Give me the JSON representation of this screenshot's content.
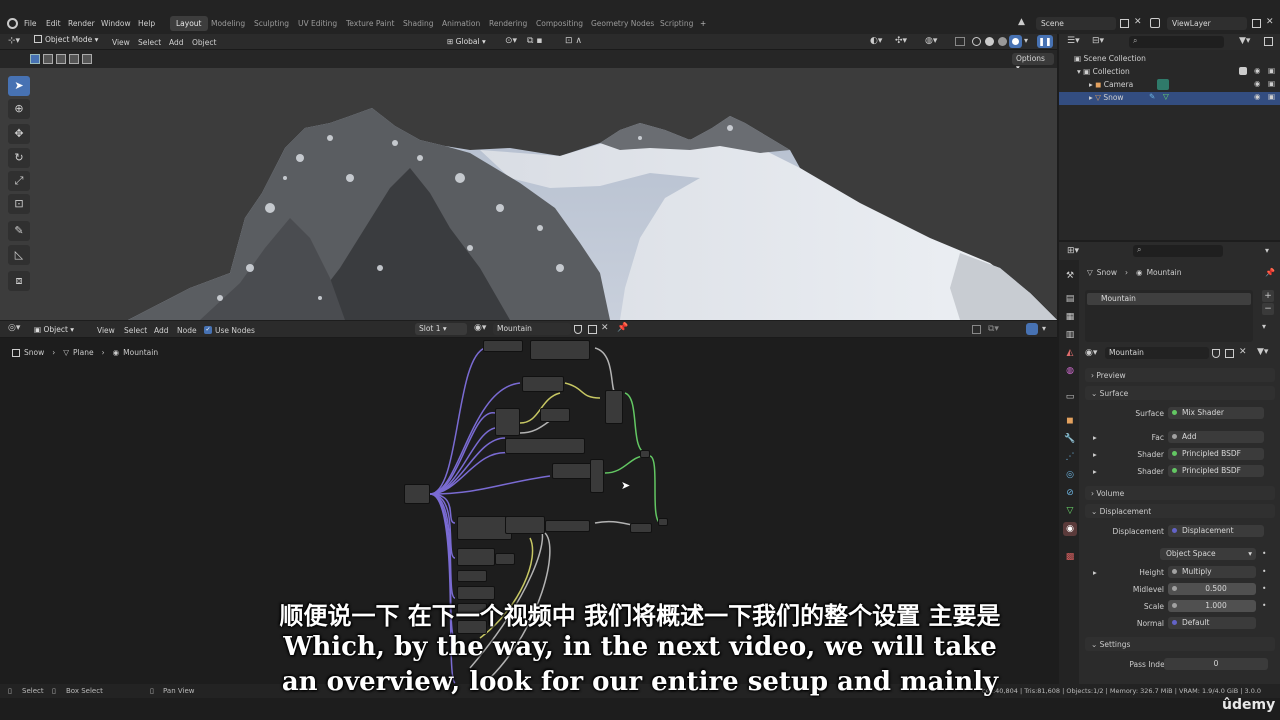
{
  "topbar": {
    "menus": [
      "File",
      "Edit",
      "Render",
      "Window",
      "Help"
    ],
    "workspaces": [
      "Layout",
      "Modeling",
      "Sculpting",
      "UV Editing",
      "Texture Paint",
      "Shading",
      "Animation",
      "Rendering",
      "Compositing",
      "Geometry Nodes",
      "Scripting"
    ],
    "add_tab": "+",
    "scene": "Scene",
    "view_layer": "ViewLayer"
  },
  "viewport": {
    "mode": "Object Mode",
    "menus": [
      "View",
      "Select",
      "Add",
      "Object"
    ],
    "orientation": "Global",
    "options_label": "Options"
  },
  "outliner": {
    "root": "Scene Collection",
    "items": [
      {
        "label": "Collection"
      },
      {
        "label": "Camera"
      },
      {
        "label": "Snow"
      }
    ]
  },
  "node_editor": {
    "type": "Object",
    "menus": [
      "View",
      "Select",
      "Add",
      "Node"
    ],
    "use_nodes_label": "Use Nodes",
    "slot": "Slot 1",
    "material": "Mountain",
    "breadcrumb": [
      "Snow",
      "Plane",
      "Mountain"
    ]
  },
  "properties": {
    "breadcrumb": [
      "Snow",
      "Mountain"
    ],
    "material_slot": "Mountain",
    "material_name": "Mountain",
    "sections": {
      "preview": "Preview",
      "surface": "Surface",
      "volume": "Volume",
      "displacement": "Displacement",
      "settings": "Settings"
    },
    "surface_rows": [
      {
        "label": "Surface",
        "value": "Mix Shader",
        "color": "#63c763"
      },
      {
        "label": "Fac",
        "value": "Add",
        "color": "#63c763"
      },
      {
        "label": "Shader",
        "value": "Principled BSDF",
        "color": "#63c763"
      },
      {
        "label": "Shader",
        "value": "Principled BSDF",
        "color": "#63c763"
      }
    ],
    "displacement_rows": [
      {
        "label": "Displacement",
        "value": "Displacement",
        "color": "#6363c7"
      },
      {
        "label": "",
        "value": "Object Space"
      },
      {
        "label": "Height",
        "value": "Multiply",
        "color": "#a1a1a1"
      },
      {
        "label": "Midlevel",
        "value": "0.500",
        "color": "#a1a1a1"
      },
      {
        "label": "Scale",
        "value": "1.000",
        "color": "#a1a1a1"
      },
      {
        "label": "Normal",
        "value": "Default",
        "color": "#6363c7"
      }
    ],
    "pass_index_label": "Pass Index",
    "pass_index_value": "0"
  },
  "statusbar": {
    "select": "Select",
    "box_select": "Box Select",
    "pan_view": "Pan View",
    "stats": "ces:40,804 | Tris:81,608 | Objects:1/2 | Memory: 326.7 MiB | VRAM: 1.9/4.0 GiB | 3.0.0"
  },
  "subtitles": {
    "chinese": "顺便说一下 在下一个视频中 我们将概述一下我们的整个设置 主要是",
    "english_line1": "Which, by the way, in the next video, we will take",
    "english_line2": "an overview, look for our entire setup and mainly"
  },
  "watermark": "ûdemy"
}
